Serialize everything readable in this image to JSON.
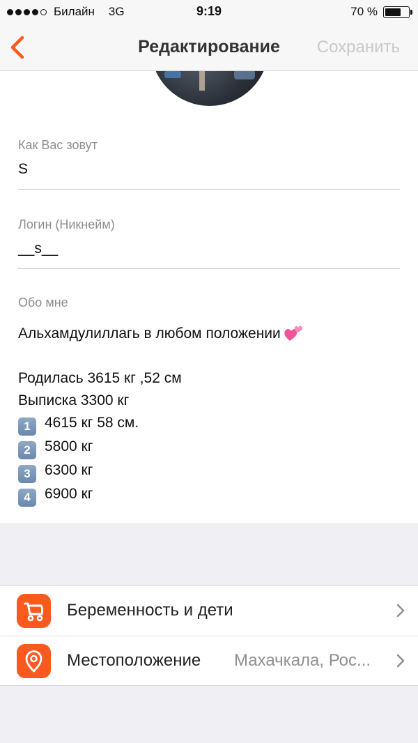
{
  "status_bar": {
    "carrier": "Билайн",
    "network": "3G",
    "time": "9:19",
    "battery_text": "70 %",
    "battery_level": 0.7
  },
  "nav": {
    "title": "Редактирование",
    "save_label": "Сохранить"
  },
  "profile": {
    "name_label": "Как Вас зовут",
    "name_value": "S",
    "login_label": "Логин (Никнейм)",
    "login_value": "__s__",
    "about_label": "Обо мне",
    "about_lines": [
      "Альхамдулиллагь в любом положении",
      "",
      "Родилась 3615 кг ,52 см",
      "Выписка 3300 кг",
      "4615 кг 58 см.",
      "5800 кг",
      "6300 кг",
      "6900 кг"
    ],
    "keycaps": [
      "1",
      "2",
      "3",
      "4"
    ]
  },
  "settings": {
    "items": [
      {
        "label": "Беременность и дети",
        "icon": "stroller-icon",
        "detail": ""
      },
      {
        "label": "Местоположение",
        "icon": "location-pin-icon",
        "detail": "Махачкала, Рос..."
      }
    ]
  },
  "colors": {
    "accent": "#fb5a1f",
    "label_gray": "#8e8e93",
    "disabled": "#c9c9cd"
  }
}
